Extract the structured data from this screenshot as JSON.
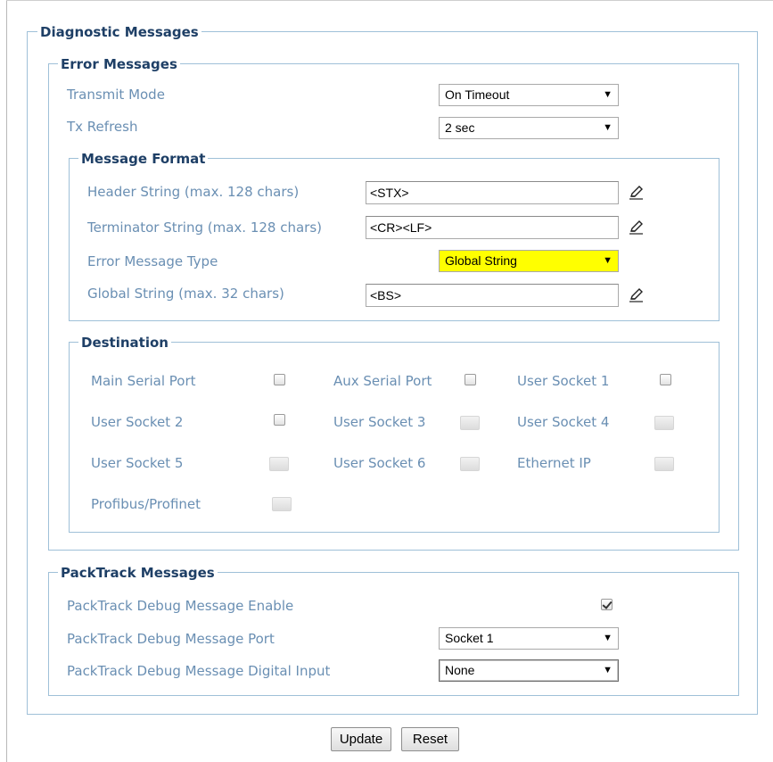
{
  "diagnostic": {
    "title": "Diagnostic Messages",
    "error": {
      "title": "Error Messages",
      "transmit_mode": {
        "label": "Transmit Mode",
        "value": "On Timeout"
      },
      "tx_refresh": {
        "label": "Tx Refresh",
        "value": "2 sec"
      },
      "format": {
        "title": "Message Format",
        "header": {
          "label": "Header String (max. 128 chars)",
          "value": "<STX>"
        },
        "terminator": {
          "label": "Terminator String (max. 128 chars)",
          "value": "<CR><LF>"
        },
        "type": {
          "label": "Error Message Type",
          "value": "Global String",
          "highlight": "#ffff00"
        },
        "global": {
          "label": "Global String (max. 32 chars)",
          "value": "<BS>"
        }
      },
      "destination": {
        "title": "Destination",
        "items": [
          {
            "label": "Main Serial Port",
            "checked": false,
            "enabled": true
          },
          {
            "label": "Aux Serial Port",
            "checked": false,
            "enabled": true
          },
          {
            "label": "User Socket 1",
            "checked": false,
            "enabled": true
          },
          {
            "label": "User Socket 2",
            "checked": false,
            "enabled": true
          },
          {
            "label": "User Socket 3",
            "checked": false,
            "enabled": false
          },
          {
            "label": "User Socket 4",
            "checked": false,
            "enabled": false
          },
          {
            "label": "User Socket 5",
            "checked": false,
            "enabled": false
          },
          {
            "label": "User Socket 6",
            "checked": false,
            "enabled": false
          },
          {
            "label": "Ethernet IP",
            "checked": false,
            "enabled": false
          },
          {
            "label": "Profibus/Profinet",
            "checked": false,
            "enabled": false
          }
        ]
      }
    },
    "packtrack": {
      "title": "PackTrack Messages",
      "debug_enable": {
        "label": "PackTrack Debug Message Enable",
        "checked": true
      },
      "debug_port": {
        "label": "PackTrack Debug Message Port",
        "value": "Socket 1"
      },
      "debug_input": {
        "label": "PackTrack Debug Message Digital Input",
        "value": "None"
      }
    }
  },
  "actions": {
    "update": "Update",
    "reset": "Reset"
  },
  "icons": {
    "edit": "pencil-icon",
    "dropdown": "dropdown-arrow-icon"
  },
  "colors": {
    "label": "#6a8fb3",
    "heading": "#1e3f66",
    "border": "#9fc0d8",
    "highlight": "#ffff00"
  }
}
